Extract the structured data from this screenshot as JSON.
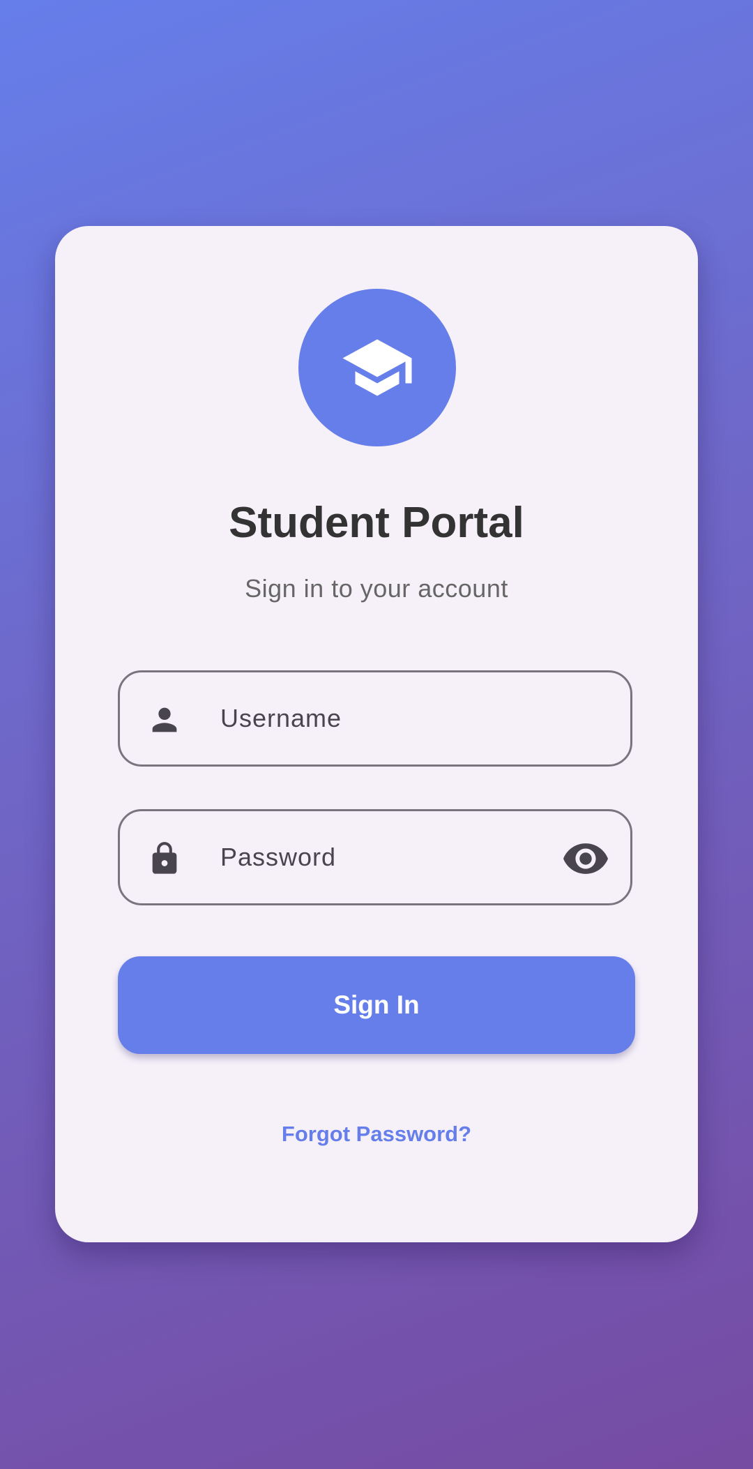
{
  "app": {
    "title": "Student Portal",
    "subtitle": "Sign in to your account"
  },
  "logo": {
    "icon": "graduation-cap-icon"
  },
  "form": {
    "username": {
      "placeholder": "Username",
      "value": "",
      "icon": "person-icon"
    },
    "password": {
      "placeholder": "Password",
      "value": "",
      "icon": "lock-icon",
      "toggle_icon": "eye-icon"
    },
    "submit_label": "Sign In",
    "forgot_label": "Forgot Password?"
  },
  "colors": {
    "accent": "#667eea",
    "gradient_start": "#667eea",
    "gradient_end": "#764ba2",
    "card_background": "#f6f1f9",
    "title_text": "#333333",
    "subtitle_text": "#666666",
    "field_border": "#79747e",
    "icon_color": "#49454f"
  }
}
